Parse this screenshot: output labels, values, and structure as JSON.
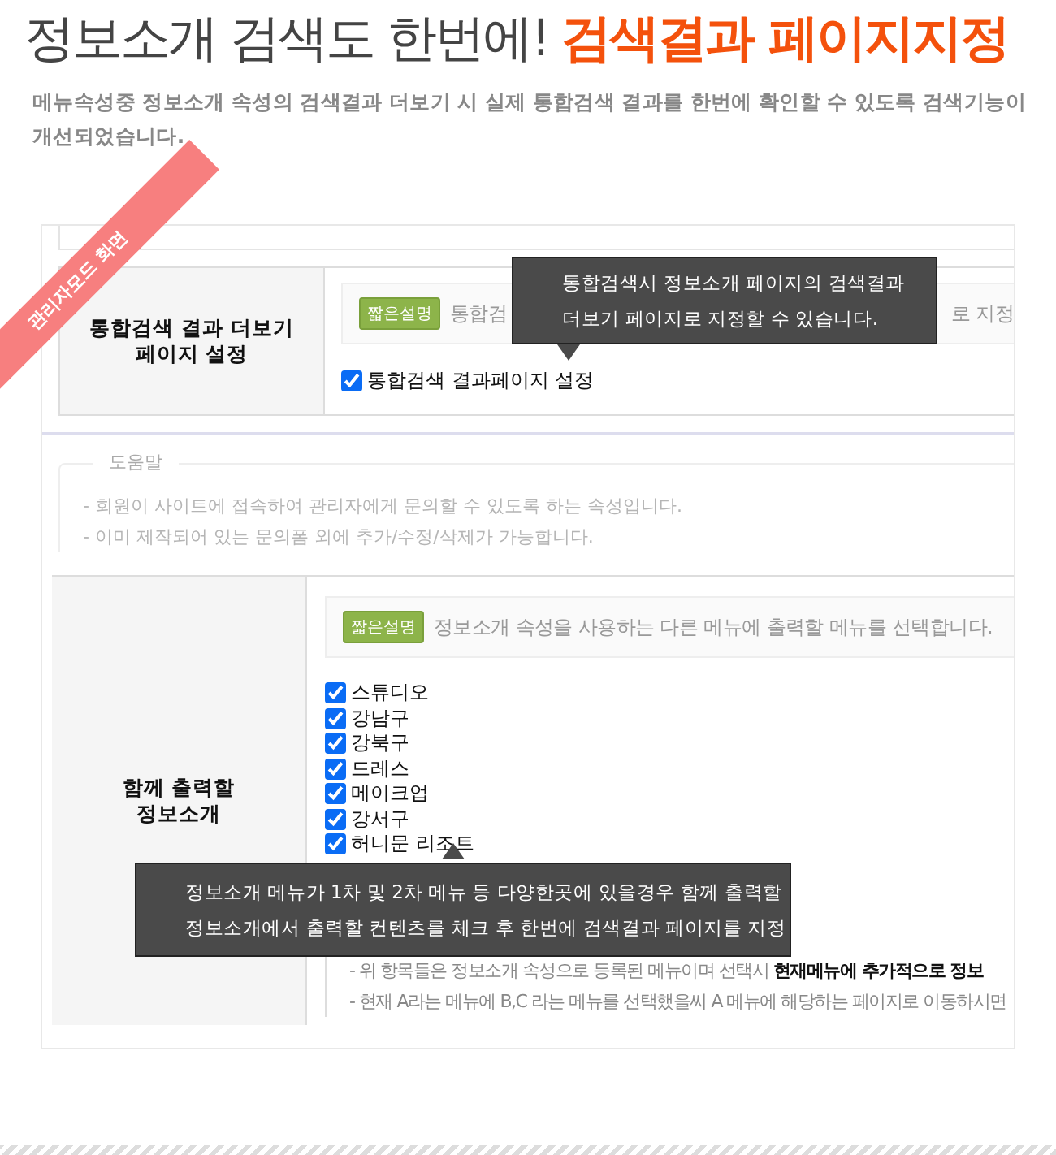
{
  "title": {
    "lead": "정보소개 검색도 한번에!",
    "highlight": "검색결과 페이지지정"
  },
  "subtitle": "메뉴속성중 정보소개 속성의 검색결과 더보기 시 실제 통합검색 결과를 한번에 확인할 수 있도록 검색기능이 개선되었습니다.",
  "ribbon": "관리자모드 화면",
  "result_page_section": {
    "label": "통합검색 결과 더보기\n페이지 설정",
    "badge": "짧은설명",
    "description_parts": [
      "통합검",
      "로 지정"
    ],
    "options": [
      {
        "label": "통합검색 결과페이지 설정",
        "checked": true
      }
    ],
    "tooltip": "통합검색시 정보소개 페이지의 검색결과\n더보기 페이지로 지정할 수 있습니다."
  },
  "help": {
    "title": "도움말",
    "lines": [
      "- 회원이 사이트에 접속하여 관리자에게 문의할 수 있도록 하는 속성입니다.",
      "- 이미 제작되어 있는 문의폼 외에 추가/수정/삭제가 가능합니다."
    ]
  },
  "output_section": {
    "label": "함께 출력할\n정보소개",
    "badge": "짧은설명",
    "description": "정보소개 속성을 사용하는 다른 메뉴에 출력할 메뉴를 선택합니다.",
    "options": [
      {
        "label": "스튜디오",
        "checked": true
      },
      {
        "label": "강남구",
        "checked": true
      },
      {
        "label": "강북구",
        "checked": true
      },
      {
        "label": "드레스",
        "checked": true
      },
      {
        "label": "메이크업",
        "checked": true
      },
      {
        "label": "강서구",
        "checked": true
      },
      {
        "label": "허니문 리조트",
        "checked": true
      }
    ],
    "tooltip": "정보소개 메뉴가 1차 및 2차 메뉴 등 다양한곳에 있을경우 함께 출력할\n정보소개에서 출력할 컨텐츠를 체크 후 한번에 검색결과 페이지를 지정",
    "notes": [
      "- 위 항목들은 정보소개 속성으로 등록된 메뉴이며 선택시 **현재메뉴에 추가적으로 정보**",
      "- 현재 A라는 메뉴에 B,C 라는 메뉴를 선택했을씨 A 메뉴에 해당하는 페이지로 이동하시면"
    ]
  }
}
